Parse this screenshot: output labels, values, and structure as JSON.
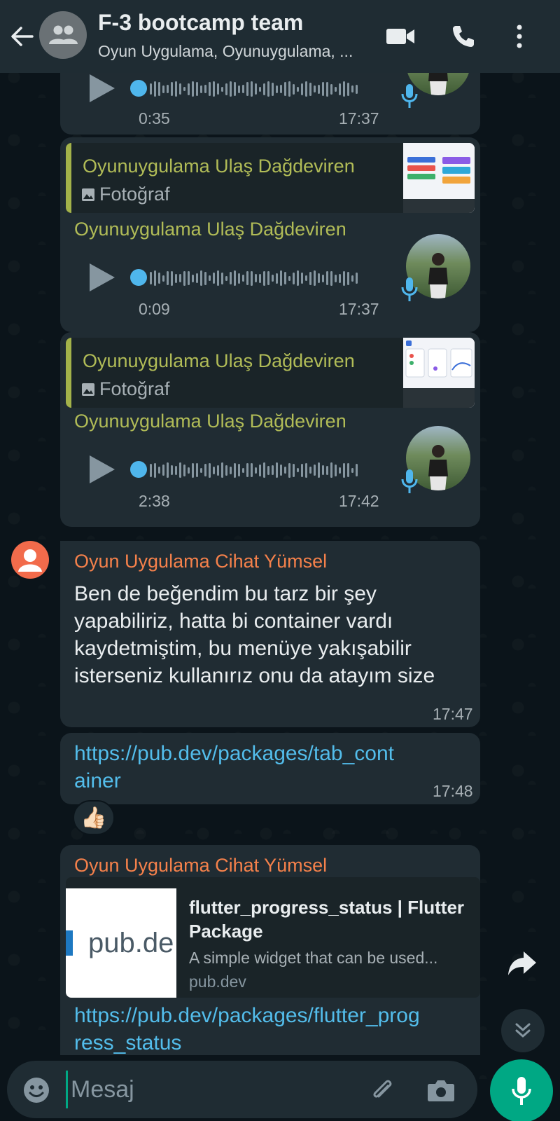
{
  "header": {
    "title": "F-3 bootcamp team",
    "subtitle": "Oyun Uygulama, Oyunuygulama, ..."
  },
  "messages": {
    "voice1": {
      "duration": "0:35",
      "time": "17:37"
    },
    "voice2": {
      "quote_sender": "Oyunuygulama Ulaş Dağdeviren",
      "quote_type": "Fotoğraf",
      "sender": "Oyunuygulama Ulaş Dağdeviren",
      "duration": "0:09",
      "time": "17:37"
    },
    "voice3": {
      "quote_sender": "Oyunuygulama Ulaş Dağdeviren",
      "quote_type": "Fotoğraf",
      "sender": "Oyunuygulama Ulaş Dağdeviren",
      "duration": "2:38",
      "time": "17:42"
    },
    "text1": {
      "sender": "Oyun Uygulama Cihat Yümsel",
      "text": "Ben de beğendim bu tarz bir şey yapabiliriz, hatta bi container vardı kaydetmiştim, bu menüye yakışabilir isterseniz kullanırız onu da atayım size",
      "time": "17:47"
    },
    "link1": {
      "text": "https://pub.dev/packages/tab_container",
      "time": "17:48",
      "reaction": "👍🏻"
    },
    "link2": {
      "sender": "Oyun Uygulama Cihat Yümsel",
      "preview_image_text": "pub.de",
      "preview_title": "flutter_progress_status | Flutter Package",
      "preview_desc": "A simple widget that can be used...",
      "preview_domain": "pub.dev",
      "text": "https://pub.dev/packages/flutter_progress_status"
    }
  },
  "composer": {
    "placeholder": "Mesaj"
  },
  "colors": {
    "header_bg": "#1f2c33",
    "bubble_bg": "#202c33",
    "sender_green": "#b1bc57",
    "sender_orange": "#f5814b",
    "link": "#53bdeb",
    "accent": "#00a884"
  },
  "icons": [
    "back-arrow-icon",
    "group-icon",
    "video-call-icon",
    "phone-icon",
    "more-vert-icon",
    "play-icon",
    "mic-icon",
    "photo-icon",
    "user-icon",
    "forward-icon",
    "chevrons-down-icon",
    "emoji-icon",
    "attach-icon",
    "camera-icon"
  ]
}
